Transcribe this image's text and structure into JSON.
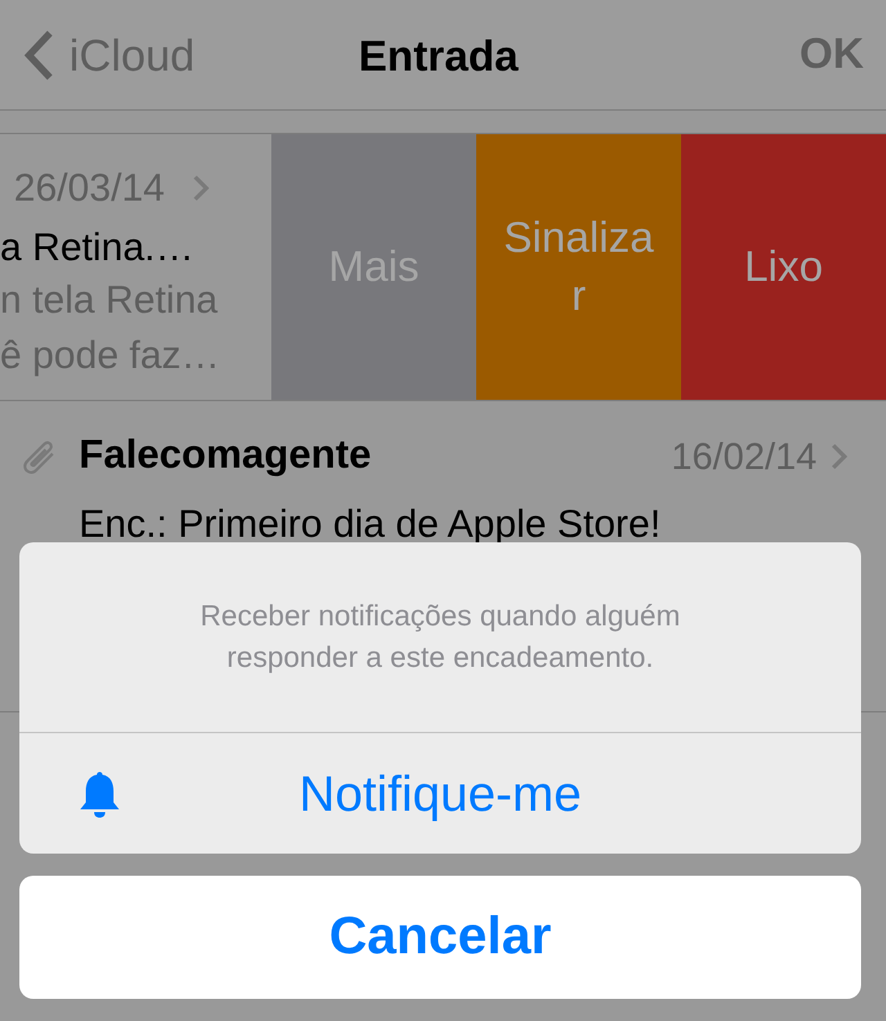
{
  "nav": {
    "back": "iCloud",
    "title": "Entrada",
    "done": "OK"
  },
  "messages": [
    {
      "kind": "swiped",
      "date": "26/03/14",
      "subject": "a Retina.…",
      "preview": [
        "n tela Retina",
        "ê pode faz…"
      ],
      "actions": [
        {
          "label": "Mais",
          "color": "#78787c"
        },
        {
          "label": "Sinalizar",
          "color": "#9b5a00"
        },
        {
          "label": "Lixo",
          "color": "#9a221e"
        }
      ]
    },
    {
      "kind": "normal",
      "attachment": true,
      "sender": "Falecomagente",
      "date": "16/02/14",
      "subject": "Enc.: Primeiro dia de Apple Store!"
    }
  ],
  "action_sheet": {
    "message": "Receber notificações quando alguém responder a este encadeamento.",
    "actions": [
      {
        "label": "Notifique-me"
      }
    ],
    "cancel": "Cancelar"
  }
}
